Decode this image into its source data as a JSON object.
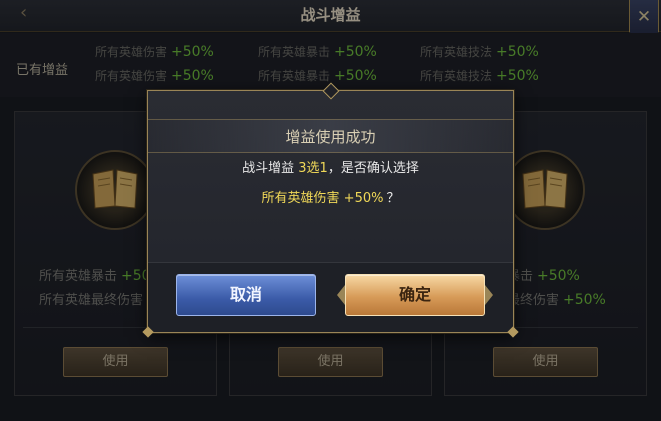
{
  "header": {
    "title": "战斗增益",
    "back_icon": "back-arrow-icon",
    "close_icon": "close-icon"
  },
  "owned": {
    "label": "已有增益",
    "buffs": [
      {
        "name": "所有英雄伤害",
        "value": "+50%"
      },
      {
        "name": "所有英雄暴击",
        "value": "+50%"
      },
      {
        "name": "所有英雄技法",
        "value": "+50%"
      },
      {
        "name": "所有英雄伤害",
        "value": "+50%"
      },
      {
        "name": "所有英雄暴击",
        "value": "+50%"
      },
      {
        "name": "所有英雄技法",
        "value": "+50%"
      }
    ]
  },
  "cards": [
    {
      "icon": "book-icon",
      "line1_name": "所有英雄暴击",
      "line1_value": "+50",
      "line2_name": "所有英雄最终伤害",
      "use_label": "使用"
    },
    {
      "icon": "book-icon",
      "use_label": "使用"
    },
    {
      "icon": "book-icon",
      "line1_name": "暴击",
      "line1_value": "+50%",
      "line2_name": "最终伤害",
      "line2_value": "+50%",
      "use_label": "使用"
    }
  ],
  "dialog": {
    "title": "增益使用成功",
    "msg_prefix": "战斗增益 ",
    "msg_highlight": "3选1",
    "msg_suffix": "，是否确认选择",
    "buff_name": "所有英雄伤害",
    "buff_value": "+50%",
    "question_mark": "？",
    "cancel_label": "取消",
    "confirm_label": "确定"
  },
  "colors": {
    "buff_value": "#6fbe3e",
    "highlight": "#f0d858",
    "cancel_button": "#3b5ba8",
    "confirm_button": "#d79b58",
    "border_gold": "#9a8557"
  }
}
